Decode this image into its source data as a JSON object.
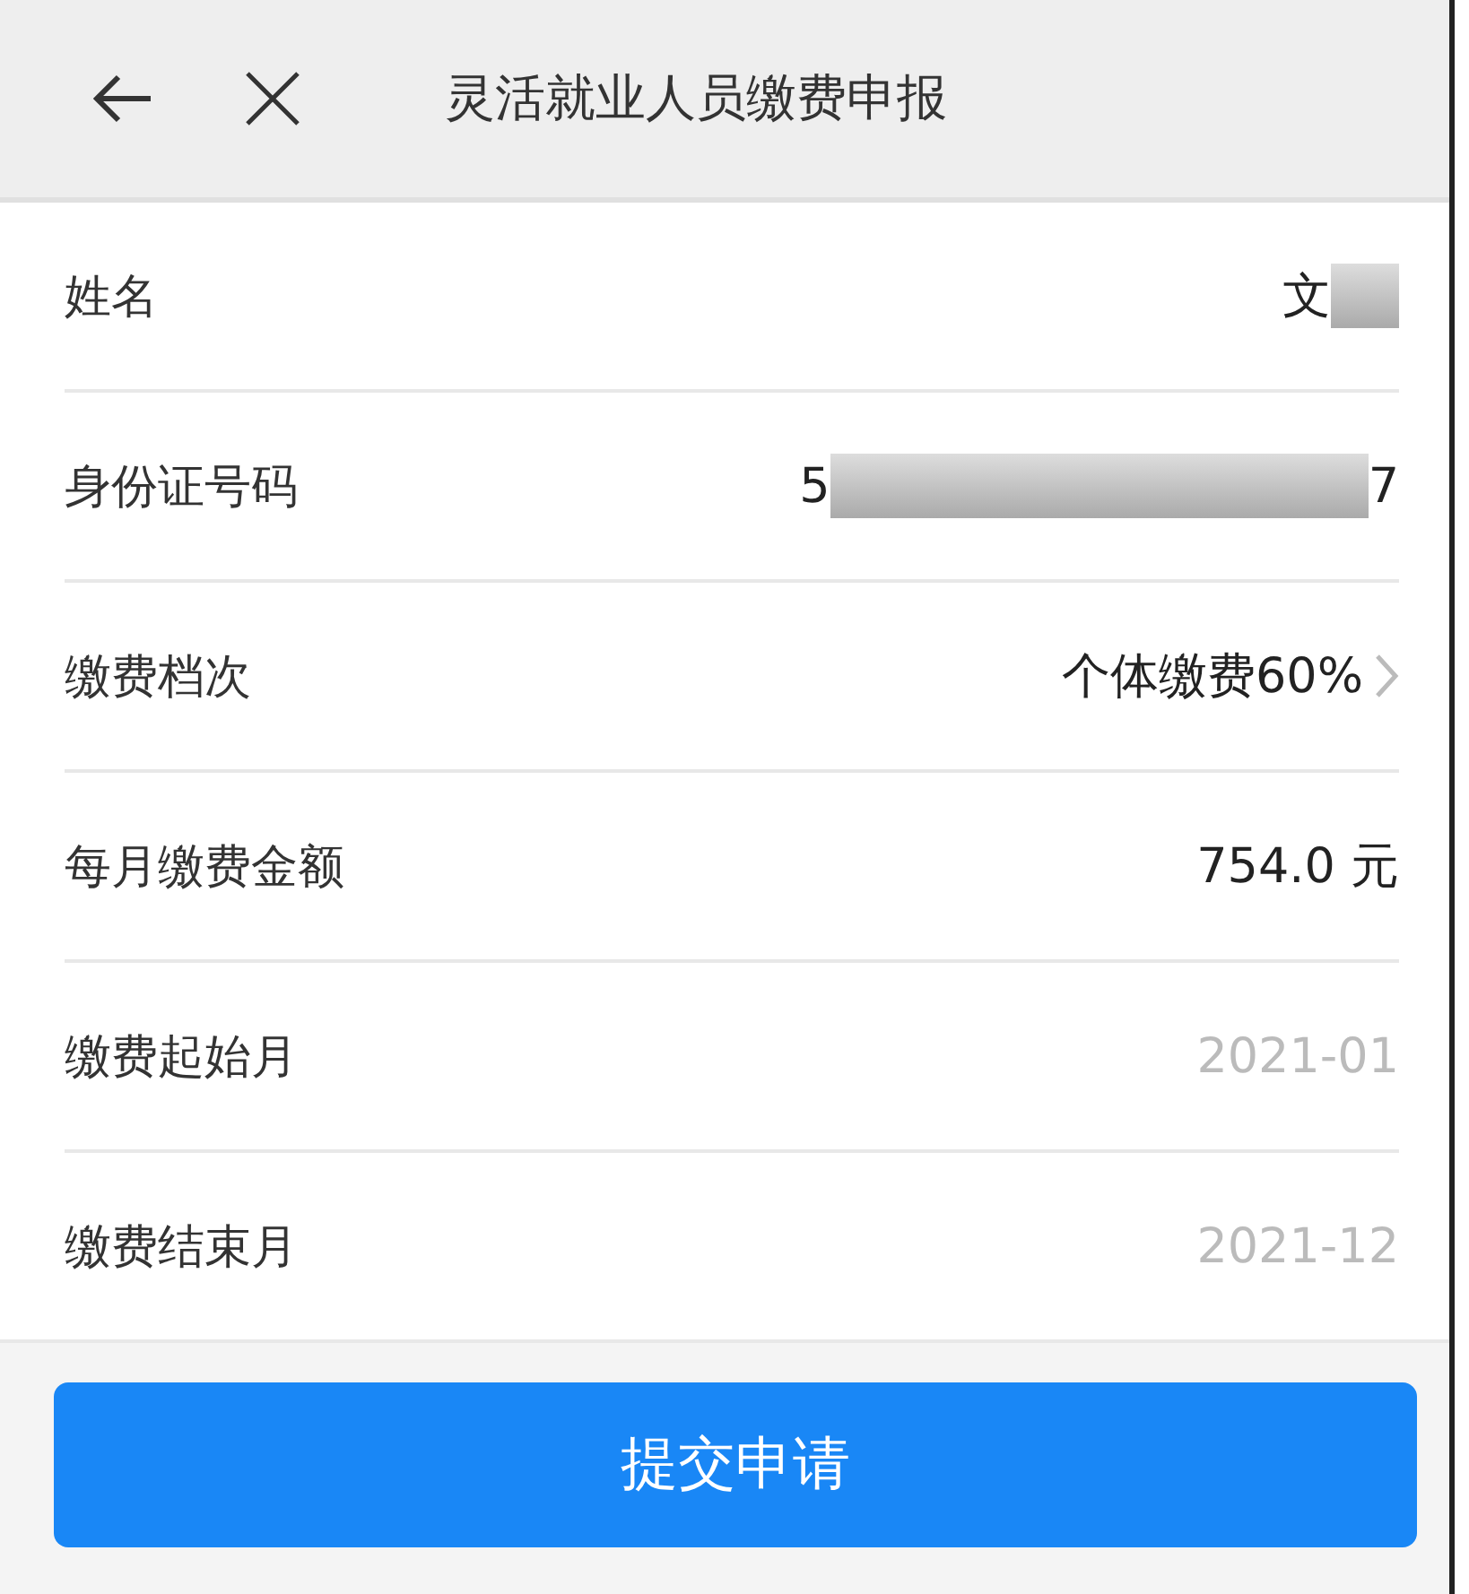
{
  "header": {
    "title": "灵活就业人员缴费申报"
  },
  "rows": [
    {
      "label": "姓名",
      "kind": "text",
      "value": "文",
      "redacted": true
    },
    {
      "label": "身份证号码",
      "kind": "text",
      "value": "5",
      "value_end": "7",
      "redacted": true
    },
    {
      "label": "缴费档次",
      "kind": "select",
      "value": "个体缴费60%"
    },
    {
      "label": "每月缴费金额",
      "kind": "text",
      "value": "754.0 元"
    },
    {
      "label": "缴费起始月",
      "kind": "date",
      "value": "2021-01"
    },
    {
      "label": "缴费结束月",
      "kind": "date",
      "value": "2021-12"
    }
  ],
  "submit_button": "提交申请"
}
